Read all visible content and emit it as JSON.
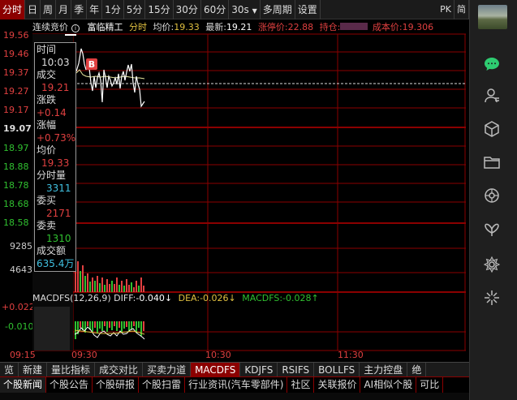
{
  "toolbar": {
    "items": [
      "分时",
      "日",
      "周",
      "月",
      "季",
      "年",
      "1分",
      "5分",
      "15分",
      "30分",
      "60分",
      "30s",
      "多周期",
      "设置"
    ],
    "dropdown_mark": "▼",
    "right_items": [
      "PK",
      "简"
    ]
  },
  "header": {
    "auction_label": "连续竞价",
    "stock_name": "富临精工",
    "mode": "分时",
    "avg_label": "均价:",
    "avg_value": "19.33",
    "last_label": "最新:",
    "last_value": "19.21",
    "limit_label": "涨停价:",
    "limit_value": "22.88",
    "position_label": "持仓:",
    "cost_label": "成本价:",
    "cost_value": "19.306"
  },
  "y_axis": {
    "price_labels": [
      "19.56",
      "19.46",
      "19.37",
      "19.27",
      "19.17",
      "19.07",
      "18.97",
      "18.88",
      "18.78",
      "18.68",
      "18.58"
    ],
    "volume_labels": [
      "9285",
      "4643"
    ],
    "macd_labels": [
      "+0.022",
      "-0.010"
    ]
  },
  "info_panel": {
    "time_label": "时间",
    "time_value": "10:03",
    "vol_label": "成交",
    "vol_value": "19.21",
    "change_label": "涨跌",
    "change_value": "+0.14",
    "pct_label": "涨幅",
    "pct_value": "+0.73%",
    "avg_label": "均价",
    "avg_value": "19.33",
    "tvol_label": "分时量",
    "tvol_value": "3311",
    "bid_label": "委买",
    "bid_value": "2171",
    "ask_label": "委卖",
    "ask_value": "1310",
    "amt_label": "成交额",
    "amt_value": "635.4万"
  },
  "marker": "B",
  "macd": {
    "title": "MACDFS(12,26,9)",
    "diff_label": "DIFF:",
    "diff_value": "-0.040↓",
    "dea_label": "DEA:",
    "dea_value": "-0.026↓",
    "macdfs_label": "MACDFS:",
    "macdfs_value": "-0.028↑"
  },
  "x_axis": [
    "09:15",
    "09:30",
    "10:30",
    "11:30"
  ],
  "tabs_row1": [
    "览",
    "新建",
    "量比指标",
    "成交对比",
    "买卖力道",
    "MACDFS",
    "KDJFS",
    "RSIFS",
    "BOLLFS",
    "主力控盘",
    "绝"
  ],
  "tabs_row1_active": "MACDFS",
  "tabs_row2": [
    "个股新闻",
    "个股公告",
    "个股研报",
    "个股扫雷",
    "行业资讯(汽车零部件)",
    "社区",
    "关联报价",
    "AI相似个股",
    "可比"
  ],
  "tabs_row2_active": "个股新闻",
  "colors": {
    "up": "#e04040",
    "down": "#30c030",
    "grid": "#8b0000",
    "accent": "#8b0000",
    "info": "#40c0e0"
  },
  "sidebar_icons": [
    "chat-icon",
    "user-icon",
    "cube-icon",
    "folder-icon",
    "aperture-icon",
    "butterfly-icon",
    "gear-flower-icon",
    "star-icon"
  ]
}
